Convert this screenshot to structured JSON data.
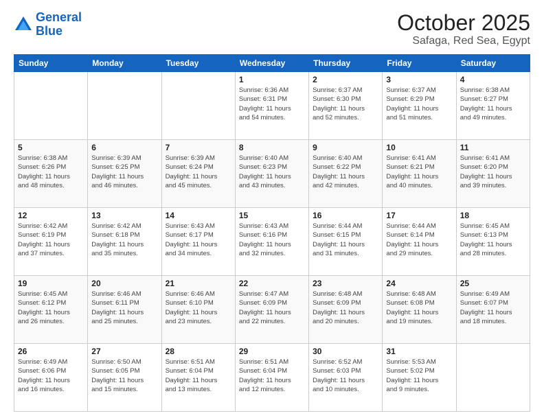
{
  "header": {
    "logo_line1": "General",
    "logo_line2": "Blue",
    "title": "October 2025",
    "subtitle": "Safaga, Red Sea, Egypt"
  },
  "days_of_week": [
    "Sunday",
    "Monday",
    "Tuesday",
    "Wednesday",
    "Thursday",
    "Friday",
    "Saturday"
  ],
  "weeks": [
    [
      {
        "day": "",
        "info": ""
      },
      {
        "day": "",
        "info": ""
      },
      {
        "day": "",
        "info": ""
      },
      {
        "day": "1",
        "info": "Sunrise: 6:36 AM\nSunset: 6:31 PM\nDaylight: 11 hours\nand 54 minutes."
      },
      {
        "day": "2",
        "info": "Sunrise: 6:37 AM\nSunset: 6:30 PM\nDaylight: 11 hours\nand 52 minutes."
      },
      {
        "day": "3",
        "info": "Sunrise: 6:37 AM\nSunset: 6:29 PM\nDaylight: 11 hours\nand 51 minutes."
      },
      {
        "day": "4",
        "info": "Sunrise: 6:38 AM\nSunset: 6:27 PM\nDaylight: 11 hours\nand 49 minutes."
      }
    ],
    [
      {
        "day": "5",
        "info": "Sunrise: 6:38 AM\nSunset: 6:26 PM\nDaylight: 11 hours\nand 48 minutes."
      },
      {
        "day": "6",
        "info": "Sunrise: 6:39 AM\nSunset: 6:25 PM\nDaylight: 11 hours\nand 46 minutes."
      },
      {
        "day": "7",
        "info": "Sunrise: 6:39 AM\nSunset: 6:24 PM\nDaylight: 11 hours\nand 45 minutes."
      },
      {
        "day": "8",
        "info": "Sunrise: 6:40 AM\nSunset: 6:23 PM\nDaylight: 11 hours\nand 43 minutes."
      },
      {
        "day": "9",
        "info": "Sunrise: 6:40 AM\nSunset: 6:22 PM\nDaylight: 11 hours\nand 42 minutes."
      },
      {
        "day": "10",
        "info": "Sunrise: 6:41 AM\nSunset: 6:21 PM\nDaylight: 11 hours\nand 40 minutes."
      },
      {
        "day": "11",
        "info": "Sunrise: 6:41 AM\nSunset: 6:20 PM\nDaylight: 11 hours\nand 39 minutes."
      }
    ],
    [
      {
        "day": "12",
        "info": "Sunrise: 6:42 AM\nSunset: 6:19 PM\nDaylight: 11 hours\nand 37 minutes."
      },
      {
        "day": "13",
        "info": "Sunrise: 6:42 AM\nSunset: 6:18 PM\nDaylight: 11 hours\nand 35 minutes."
      },
      {
        "day": "14",
        "info": "Sunrise: 6:43 AM\nSunset: 6:17 PM\nDaylight: 11 hours\nand 34 minutes."
      },
      {
        "day": "15",
        "info": "Sunrise: 6:43 AM\nSunset: 6:16 PM\nDaylight: 11 hours\nand 32 minutes."
      },
      {
        "day": "16",
        "info": "Sunrise: 6:44 AM\nSunset: 6:15 PM\nDaylight: 11 hours\nand 31 minutes."
      },
      {
        "day": "17",
        "info": "Sunrise: 6:44 AM\nSunset: 6:14 PM\nDaylight: 11 hours\nand 29 minutes."
      },
      {
        "day": "18",
        "info": "Sunrise: 6:45 AM\nSunset: 6:13 PM\nDaylight: 11 hours\nand 28 minutes."
      }
    ],
    [
      {
        "day": "19",
        "info": "Sunrise: 6:45 AM\nSunset: 6:12 PM\nDaylight: 11 hours\nand 26 minutes."
      },
      {
        "day": "20",
        "info": "Sunrise: 6:46 AM\nSunset: 6:11 PM\nDaylight: 11 hours\nand 25 minutes."
      },
      {
        "day": "21",
        "info": "Sunrise: 6:46 AM\nSunset: 6:10 PM\nDaylight: 11 hours\nand 23 minutes."
      },
      {
        "day": "22",
        "info": "Sunrise: 6:47 AM\nSunset: 6:09 PM\nDaylight: 11 hours\nand 22 minutes."
      },
      {
        "day": "23",
        "info": "Sunrise: 6:48 AM\nSunset: 6:09 PM\nDaylight: 11 hours\nand 20 minutes."
      },
      {
        "day": "24",
        "info": "Sunrise: 6:48 AM\nSunset: 6:08 PM\nDaylight: 11 hours\nand 19 minutes."
      },
      {
        "day": "25",
        "info": "Sunrise: 6:49 AM\nSunset: 6:07 PM\nDaylight: 11 hours\nand 18 minutes."
      }
    ],
    [
      {
        "day": "26",
        "info": "Sunrise: 6:49 AM\nSunset: 6:06 PM\nDaylight: 11 hours\nand 16 minutes."
      },
      {
        "day": "27",
        "info": "Sunrise: 6:50 AM\nSunset: 6:05 PM\nDaylight: 11 hours\nand 15 minutes."
      },
      {
        "day": "28",
        "info": "Sunrise: 6:51 AM\nSunset: 6:04 PM\nDaylight: 11 hours\nand 13 minutes."
      },
      {
        "day": "29",
        "info": "Sunrise: 6:51 AM\nSunset: 6:04 PM\nDaylight: 11 hours\nand 12 minutes."
      },
      {
        "day": "30",
        "info": "Sunrise: 6:52 AM\nSunset: 6:03 PM\nDaylight: 11 hours\nand 10 minutes."
      },
      {
        "day": "31",
        "info": "Sunrise: 5:53 AM\nSunset: 5:02 PM\nDaylight: 11 hours\nand 9 minutes."
      },
      {
        "day": "",
        "info": ""
      }
    ]
  ]
}
